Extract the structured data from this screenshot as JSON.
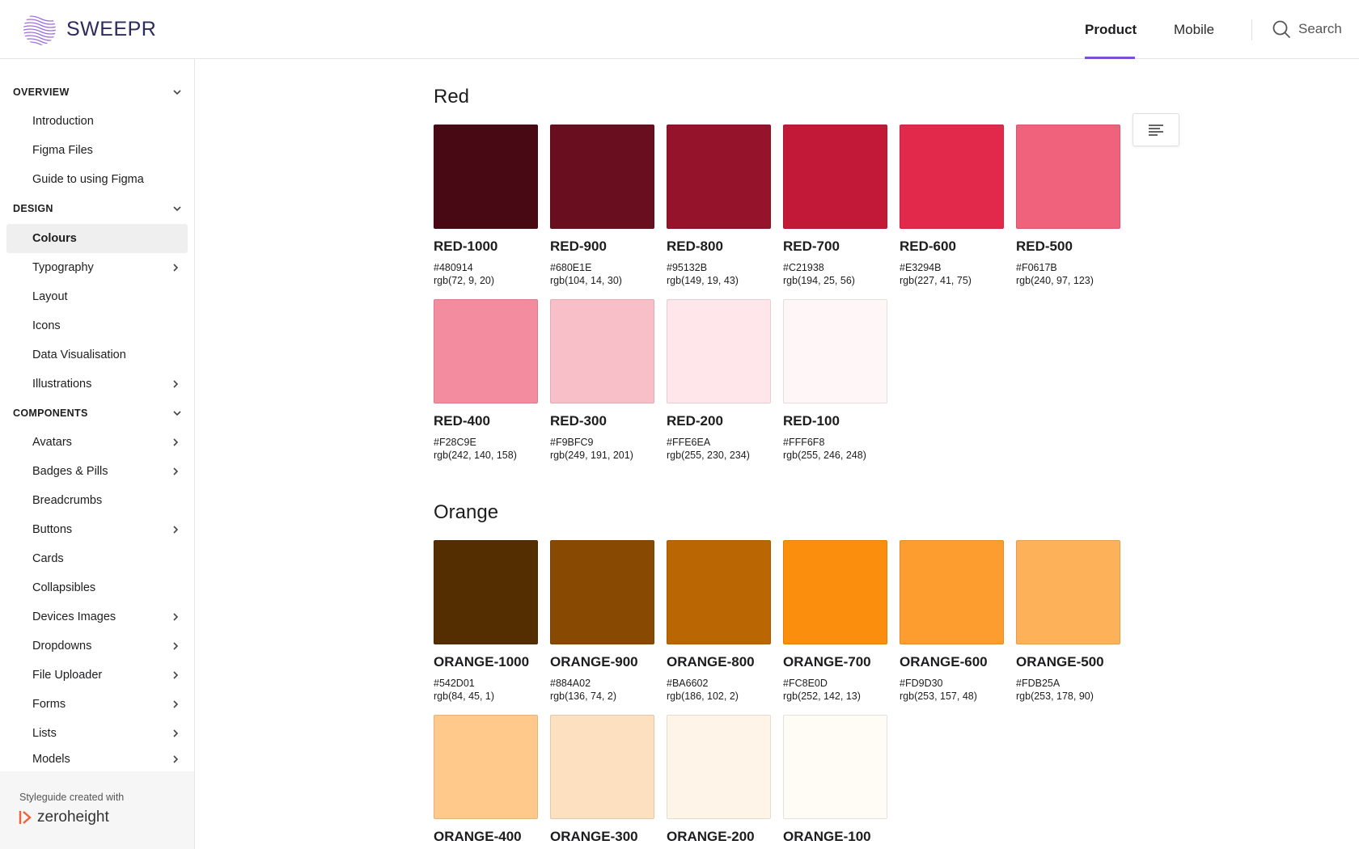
{
  "brand": {
    "name": "SWEEPR",
    "logo_icon": "sweepr-wave-logo"
  },
  "header": {
    "tabs": [
      {
        "label": "Product",
        "active": true
      },
      {
        "label": "Mobile",
        "active": false
      }
    ],
    "search_label": "Search"
  },
  "sidebar": {
    "sections": [
      {
        "label": "OVERVIEW",
        "items": [
          {
            "label": "Introduction"
          },
          {
            "label": "Figma Files"
          },
          {
            "label": "Guide to using Figma"
          }
        ]
      },
      {
        "label": "DESIGN",
        "items": [
          {
            "label": "Colours",
            "active": true
          },
          {
            "label": "Typography",
            "chevron": true
          },
          {
            "label": "Layout"
          },
          {
            "label": "Icons"
          },
          {
            "label": "Data Visualisation"
          },
          {
            "label": "Illustrations",
            "chevron": true
          }
        ]
      },
      {
        "label": "COMPONENTS",
        "items": [
          {
            "label": "Avatars",
            "chevron": true
          },
          {
            "label": "Badges & Pills",
            "chevron": true
          },
          {
            "label": "Breadcrumbs"
          },
          {
            "label": "Buttons",
            "chevron": true
          },
          {
            "label": "Cards"
          },
          {
            "label": "Collapsibles"
          },
          {
            "label": "Devices Images",
            "chevron": true
          },
          {
            "label": "Dropdowns",
            "chevron": true
          },
          {
            "label": "File Uploader",
            "chevron": true
          },
          {
            "label": "Forms",
            "chevron": true
          },
          {
            "label": "Lists",
            "chevron": true
          },
          {
            "label": "Models",
            "chevron": true
          }
        ]
      }
    ],
    "footer": {
      "made_with": "Styleguide created with",
      "vendor": "zeroheight"
    }
  },
  "palettes": [
    {
      "title": "Red",
      "swatches": [
        {
          "name": "RED-1000",
          "hex": "#480914",
          "rgb": "rgb(72, 9, 20)"
        },
        {
          "name": "RED-900",
          "hex": "#680E1E",
          "rgb": "rgb(104, 14, 30)"
        },
        {
          "name": "RED-800",
          "hex": "#95132B",
          "rgb": "rgb(149, 19, 43)"
        },
        {
          "name": "RED-700",
          "hex": "#C21938",
          "rgb": "rgb(194, 25, 56)"
        },
        {
          "name": "RED-600",
          "hex": "#E3294B",
          "rgb": "rgb(227, 41, 75)"
        },
        {
          "name": "RED-500",
          "hex": "#F0617B",
          "rgb": "rgb(240, 97, 123)"
        },
        {
          "name": "RED-400",
          "hex": "#F28C9E",
          "rgb": "rgb(242, 140, 158)"
        },
        {
          "name": "RED-300",
          "hex": "#F9BFC9",
          "rgb": "rgb(249, 191, 201)"
        },
        {
          "name": "RED-200",
          "hex": "#FFE6EA",
          "rgb": "rgb(255, 230, 234)"
        },
        {
          "name": "RED-100",
          "hex": "#FFF6F8",
          "rgb": "rgb(255, 246, 248)"
        }
      ]
    },
    {
      "title": "Orange",
      "swatches": [
        {
          "name": "ORANGE-1000",
          "hex": "#542D01",
          "rgb": "rgb(84, 45, 1)"
        },
        {
          "name": "ORANGE-900",
          "hex": "#884A02",
          "rgb": "rgb(136, 74, 2)"
        },
        {
          "name": "ORANGE-800",
          "hex": "#BA6602",
          "rgb": "rgb(186, 102, 2)"
        },
        {
          "name": "ORANGE-700",
          "hex": "#FC8E0D",
          "rgb": "rgb(252, 142, 13)"
        },
        {
          "name": "ORANGE-600",
          "hex": "#FD9D30",
          "rgb": "rgb(253, 157, 48)"
        },
        {
          "name": "ORANGE-500",
          "hex": "#FDB25A",
          "rgb": "rgb(253, 178, 90)"
        },
        {
          "name": "ORANGE-400",
          "swatch_color": "#FEC98B"
        },
        {
          "name": "ORANGE-300",
          "swatch_color": "#FDE0BF"
        },
        {
          "name": "ORANGE-200",
          "swatch_color": "#FFF4E8"
        },
        {
          "name": "ORANGE-100",
          "swatch_color": "#FFFBF5"
        }
      ]
    }
  ],
  "colors": {
    "accent": "#7B4FD6",
    "active_bg": "#EFEFEF",
    "zeroheight_accent": "#F0603A"
  }
}
